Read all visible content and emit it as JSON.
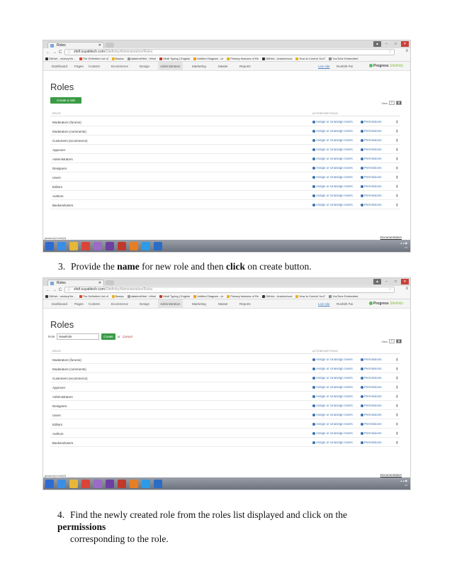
{
  "browser": {
    "tab_title": "Roles",
    "url_host": "sfstf.suyatitech.com",
    "url_path": "/Sitefinity/Administration/Roles",
    "bookmarks": [
      "GitHub - mickey/Ve...",
      "The Definitive List of",
      "Basics",
      "datatextHtml. <Html",
      "Hindi Typing | English",
      "Untitled Diagram - dr",
      "Primary features of Re",
      "GitHub - bradvin/soci",
      "How to Control YouT",
      "YouTube Embedded"
    ]
  },
  "cms_nav": {
    "items": [
      "Dashboard",
      "Pages",
      "Content",
      "Ecommerce",
      "Design",
      "Administration",
      "Marketing",
      "Master",
      "Reports"
    ],
    "live_site": "Live site",
    "user": "Roshith Pai",
    "logo_main": "Progress",
    "logo_sub": "Sitefinity"
  },
  "roles_page": {
    "title": "Roles",
    "create_button": "Create a role",
    "view_label": "View",
    "col_roles": "ROLES",
    "col_actions": "ACTIONS WITH ROLE",
    "assign_label": "Assign or Unassign Users",
    "permissions_label": "Permissions",
    "rows": [
      "Moderators (forums)",
      "Moderators (comments)",
      "Customers (ecommerce)",
      "Approver",
      "Administrators",
      "Designers",
      "Users",
      "Editors",
      "Authors",
      "BackendUsers"
    ],
    "form_label": "Role",
    "form_value": "NewRole",
    "form_create": "Create",
    "form_or": "or",
    "form_cancel": "Cancel",
    "status_url": "javascript:void(0)",
    "documentation": "Documentation"
  },
  "doc": {
    "step3_num": "3.",
    "step3_pre": "Provide the ",
    "step3_bold1": "name",
    "step3_mid": " for new role and then ",
    "step3_bold2": "click",
    "step3_post": " on create button.",
    "step4_num": "4.",
    "step4_pre": "Find the newly created role from the roles list displayed and click on the ",
    "step4_bold": "permissions",
    "step4_line2": "corresponding to the role."
  }
}
